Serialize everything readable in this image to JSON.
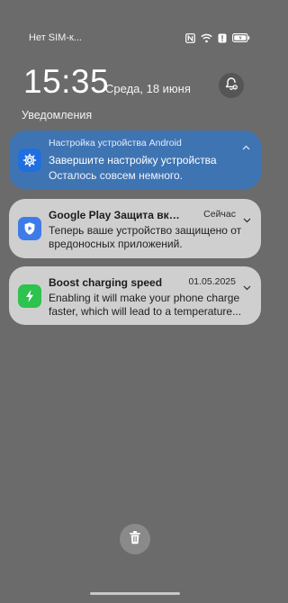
{
  "status_bar": {
    "carrier": "Нет SIM-к...",
    "icons": [
      "nfc-icon",
      "wifi-icon",
      "alert-icon",
      "battery-icon"
    ]
  },
  "lockscreen": {
    "time": "15:35",
    "date": "Среда, 18 июня"
  },
  "section_title": "Уведомления",
  "notifications": [
    {
      "app_name": "Настройка устройства Android",
      "title": "Завершите настройку устройства",
      "body": "Осталось совсем немного.",
      "icon": "gear-icon",
      "color": "#3f74b3"
    },
    {
      "title": "Google Play Защита включе...",
      "time": "Сейчас",
      "body": "Теперь ваше устройство защищено от вредоносных приложений.",
      "icon": "shield-play-icon",
      "color": "#cfcfcf"
    },
    {
      "title": "Boost charging speed",
      "time": "01.05.2025",
      "body_line1": "Enabling it will make your phone charge",
      "body_line2": "faster, which will lead to a temperature...",
      "icon": "bolt-icon",
      "color": "#cfcfcf"
    }
  ],
  "actions": {
    "clear_all_icon": "trash-icon",
    "settings_icon": "notification-settings-icon"
  }
}
